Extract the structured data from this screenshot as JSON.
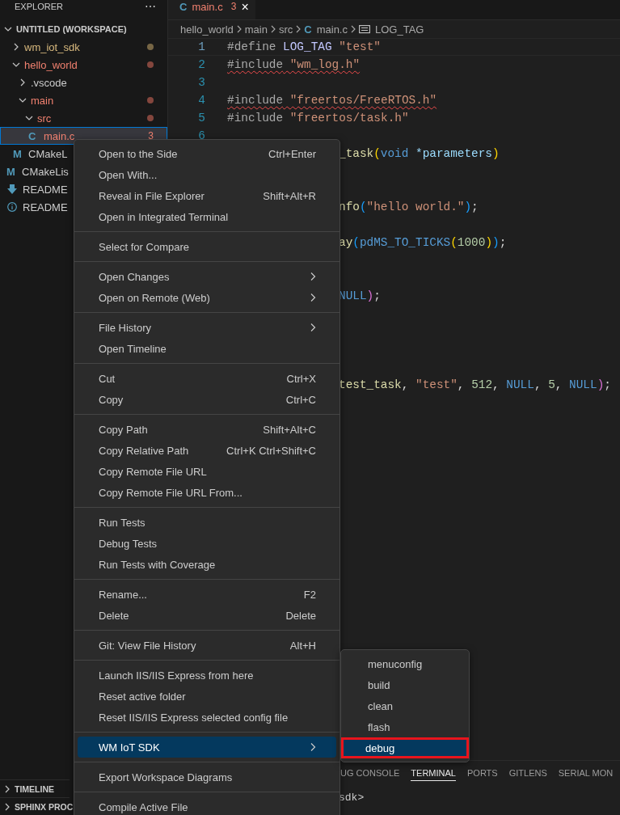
{
  "sidebar": {
    "title": "EXPLORER",
    "more": "⋯",
    "workspace": {
      "label": "UNTITLED (WORKSPACE)",
      "expanded": true,
      "children": [
        {
          "label": "wm_iot_sdk",
          "kind": "folder",
          "expanded": false,
          "selected": false,
          "color": "#d8b97e",
          "dot": true
        },
        {
          "label": "hello_world",
          "kind": "folder",
          "expanded": true,
          "selected": false,
          "color": "#f0806f",
          "dot": true,
          "children": [
            {
              "label": ".vscode",
              "kind": "folder",
              "expanded": false,
              "selected": false
            },
            {
              "label": "main",
              "kind": "folder",
              "expanded": true,
              "selected": false,
              "color": "#f0806f",
              "dot": true,
              "children": [
                {
                  "label": "src",
                  "kind": "folder",
                  "expanded": true,
                  "selected": false,
                  "color": "#f0806f",
                  "dot": true,
                  "children": [
                    {
                      "label": "main.c",
                      "kind": "c-file",
                      "glyph": "C",
                      "selected": true,
                      "color": "#f0806f",
                      "badge": "3"
                    }
                  ]
                },
                {
                  "label": "CMakeL",
                  "kind": "cmake-file",
                  "glyph": "M",
                  "selected": false
                }
              ]
            },
            {
              "label": "CMakeLis",
              "kind": "cmake-file",
              "glyph": "M",
              "selected": false
            },
            {
              "label": "README",
              "kind": "download-file",
              "selected": false
            },
            {
              "label": "README",
              "kind": "info-file",
              "selected": false
            }
          ]
        }
      ]
    },
    "sections": [
      {
        "label": "TIMELINE",
        "expanded": false
      },
      {
        "label": "SPHINX PROC",
        "expanded": false
      }
    ]
  },
  "editor": {
    "tabs": [
      {
        "label": "main.c",
        "glyph": "C",
        "badge": "3",
        "close": "×",
        "selected": true
      }
    ],
    "breadcrumb": [
      {
        "text": "hello_world",
        "kind": "folder"
      },
      {
        "text": "main",
        "kind": "folder"
      },
      {
        "text": "src",
        "kind": "folder"
      },
      {
        "text": "main.c",
        "kind": "file",
        "glyph": "C"
      },
      {
        "text": "LOG_TAG",
        "kind": "symbol"
      }
    ],
    "lines": [
      {
        "kind": "numbered",
        "number": "1",
        "current": true,
        "tokens": [
          {
            "text": "#define",
            "kind": "pre"
          },
          {
            "text": " LOG_TAG",
            "kind": "macro-def"
          },
          {
            "text": " \"test\"",
            "kind": "str"
          }
        ]
      },
      {
        "kind": "numbered",
        "number": "2",
        "squiggle": true,
        "tokens": [
          {
            "text": "#include",
            "kind": "pre"
          },
          {
            "text": " \"wm_log.h\"",
            "kind": "str"
          }
        ]
      },
      {
        "kind": "numbered",
        "number": "3"
      },
      {
        "kind": "numbered",
        "number": "4",
        "squiggle": true,
        "tokens": [
          {
            "text": "#include",
            "kind": "pre"
          },
          {
            "text": " \"freertos/FreeRTOS.h\"",
            "kind": "str"
          }
        ]
      },
      {
        "kind": "numbered",
        "number": "5",
        "tokens": [
          {
            "text": "#include",
            "kind": "pre"
          },
          {
            "text": " \"freertos/task.h\"",
            "kind": "str"
          }
        ]
      },
      {
        "kind": "numbered",
        "number": "6"
      },
      {
        "kind": "clipped",
        "tokens": [
          {
            "text": "_task",
            "kind": "func"
          },
          {
            "text": "(",
            "kind": "b1"
          },
          {
            "text": "void",
            "kind": "kw"
          },
          {
            "text": " *parameters",
            "kind": "param"
          },
          {
            "text": ")",
            "kind": "b1"
          }
        ]
      },
      {
        "kind": "blank"
      },
      {
        "kind": "blank"
      },
      {
        "kind": "clipped",
        "tokens": [
          {
            "text": "nfo",
            "kind": "func"
          },
          {
            "text": "(",
            "kind": "b3"
          },
          {
            "text": "\"hello world.\"",
            "kind": "str"
          },
          {
            "text": ")",
            "kind": "b3"
          },
          {
            "text": ";",
            "kind": "plain"
          }
        ]
      },
      {
        "kind": "blank"
      },
      {
        "kind": "clipped",
        "tokens": [
          {
            "text": "ay",
            "kind": "func"
          },
          {
            "text": "(",
            "kind": "b3"
          },
          {
            "text": "pdMS_TO_TICKS",
            "kind": "macro"
          },
          {
            "text": "(",
            "kind": "b1"
          },
          {
            "text": "1000",
            "kind": "num"
          },
          {
            "text": ")",
            "kind": "b1"
          },
          {
            "text": ")",
            "kind": "b3"
          },
          {
            "text": ";",
            "kind": "plain"
          }
        ]
      },
      {
        "kind": "blank"
      },
      {
        "kind": "blank"
      },
      {
        "kind": "clipped",
        "tokens": [
          {
            "text": "NULL",
            "kind": "kw"
          },
          {
            "text": ")",
            "kind": "b2"
          },
          {
            "text": ";",
            "kind": "plain"
          }
        ]
      },
      {
        "kind": "blank"
      },
      {
        "kind": "blank"
      },
      {
        "kind": "blank"
      },
      {
        "kind": "blank"
      },
      {
        "kind": "clipped",
        "tokens": [
          {
            "text": "test_task",
            "kind": "func"
          },
          {
            "text": ", ",
            "kind": "plain"
          },
          {
            "text": "\"test\"",
            "kind": "str"
          },
          {
            "text": ", ",
            "kind": "plain"
          },
          {
            "text": "512",
            "kind": "num"
          },
          {
            "text": ", ",
            "kind": "plain"
          },
          {
            "text": "NULL",
            "kind": "kw"
          },
          {
            "text": ", ",
            "kind": "plain"
          },
          {
            "text": "5",
            "kind": "num"
          },
          {
            "text": ", ",
            "kind": "plain"
          },
          {
            "text": "NULL",
            "kind": "kw"
          },
          {
            "text": ")",
            "kind": "b2"
          },
          {
            "text": ";",
            "kind": "plain"
          }
        ]
      }
    ]
  },
  "panel": {
    "tabs": [
      {
        "label": "UG CONSOLE",
        "selected": false
      },
      {
        "label": "TERMINAL",
        "selected": true
      },
      {
        "label": "PORTS",
        "selected": false
      },
      {
        "label": "GITLENS",
        "selected": false
      },
      {
        "label": "SERIAL MON",
        "selected": false
      }
    ],
    "terminal": "sdk>"
  },
  "context_menu": {
    "groups": [
      [
        {
          "label": "Open to the Side",
          "shortcut": "Ctrl+Enter",
          "selected": false
        },
        {
          "label": "Open With...",
          "selected": false
        },
        {
          "label": "Reveal in File Explorer",
          "shortcut": "Shift+Alt+R",
          "selected": false
        },
        {
          "label": "Open in Integrated Terminal",
          "selected": false
        }
      ],
      [
        {
          "label": "Select for Compare",
          "selected": false
        }
      ],
      [
        {
          "label": "Open Changes",
          "submenu": true,
          "selected": false
        },
        {
          "label": "Open on Remote (Web)",
          "submenu": true,
          "selected": false
        }
      ],
      [
        {
          "label": "File History",
          "submenu": true,
          "selected": false
        },
        {
          "label": "Open Timeline",
          "selected": false
        }
      ],
      [
        {
          "label": "Cut",
          "shortcut": "Ctrl+X",
          "selected": false
        },
        {
          "label": "Copy",
          "shortcut": "Ctrl+C",
          "selected": false
        }
      ],
      [
        {
          "label": "Copy Path",
          "shortcut": "Shift+Alt+C",
          "selected": false
        },
        {
          "label": "Copy Relative Path",
          "shortcut": "Ctrl+K Ctrl+Shift+C",
          "selected": false
        },
        {
          "label": "Copy Remote File URL",
          "selected": false
        },
        {
          "label": "Copy Remote File URL From...",
          "selected": false
        }
      ],
      [
        {
          "label": "Run Tests",
          "selected": false
        },
        {
          "label": "Debug Tests",
          "selected": false
        },
        {
          "label": "Run Tests with Coverage",
          "selected": false
        }
      ],
      [
        {
          "label": "Rename...",
          "shortcut": "F2",
          "selected": false
        },
        {
          "label": "Delete",
          "shortcut": "Delete",
          "selected": false
        }
      ],
      [
        {
          "label": "Git: View File History",
          "shortcut": "Alt+H",
          "selected": false
        }
      ],
      [
        {
          "label": "Launch IIS/IIS Express from here",
          "selected": false
        },
        {
          "label": "Reset active folder",
          "selected": false
        },
        {
          "label": "Reset IIS/IIS Express selected config file",
          "selected": false
        }
      ],
      [
        {
          "label": "WM IoT SDK",
          "submenu": true,
          "selected": true
        }
      ],
      [
        {
          "label": "Export Workspace Diagrams",
          "selected": false
        }
      ],
      [
        {
          "label": "Compile Active File",
          "selected": false
        }
      ]
    ]
  },
  "submenu": {
    "items": [
      {
        "label": "menuconfig",
        "selected": false,
        "outlined": false
      },
      {
        "label": "build",
        "selected": false,
        "outlined": false
      },
      {
        "label": "clean",
        "selected": false,
        "outlined": false
      },
      {
        "label": "flash",
        "selected": false,
        "outlined": false
      },
      {
        "label": "debug",
        "selected": true,
        "outlined": true
      }
    ]
  }
}
